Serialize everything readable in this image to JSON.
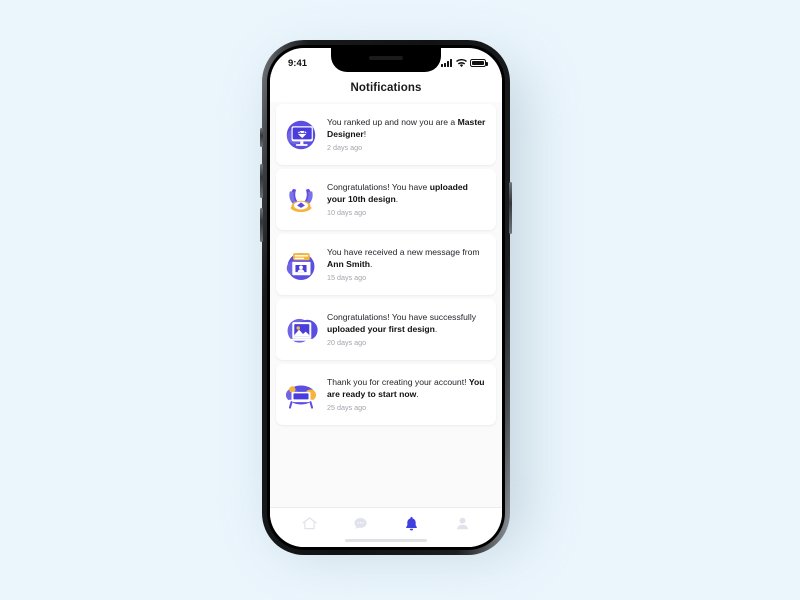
{
  "theme": {
    "page_background": "#eaf5fc",
    "accent": "#3f3fe0",
    "icon_purple": "#4b3fd9",
    "icon_light": "#7b72e8",
    "icon_accent_yellow": "#f5b53d",
    "card_background": "#ffffff",
    "list_background": "#fafafa",
    "muted_text": "#a2a5ac",
    "nav_inactive": "#e0e0e8"
  },
  "status_bar": {
    "time": "9:41",
    "signal_icon": "cellular-bars-icon",
    "wifi_icon": "wifi-icon",
    "battery_icon": "battery-full-icon"
  },
  "header": {
    "title": "Notifications"
  },
  "notifications": [
    {
      "icon": "desktop-gem-icon",
      "text_before": "You ranked up and now you are a ",
      "text_bold": "Master Designer",
      "text_after": "!",
      "time": "2 days ago"
    },
    {
      "icon": "laurel-trophy-icon",
      "text_before": "Congratulations! You have ",
      "text_bold": "uploaded your 10th design",
      "text_after": ".",
      "time": "10 days ago"
    },
    {
      "icon": "mailbox-message-icon",
      "text_before": "You have received a new message from ",
      "text_bold": "Ann Smith",
      "text_after": ".",
      "time": "15 days ago"
    },
    {
      "icon": "photo-upload-icon",
      "text_before": "Congratulations! You have successfully ",
      "text_bold": "uploaded your first design",
      "text_after": ".",
      "time": "20 days ago"
    },
    {
      "icon": "desk-workspace-icon",
      "text_before": "Thank you for creating your account! ",
      "text_bold": "You are ready to start now",
      "text_after": ".",
      "time": "25 days ago"
    }
  ],
  "bottom_nav": [
    {
      "icon": "home-icon",
      "label": "Home",
      "active": false
    },
    {
      "icon": "chat-icon",
      "label": "Messages",
      "active": false
    },
    {
      "icon": "bell-icon",
      "label": "Notifications",
      "active": true
    },
    {
      "icon": "person-icon",
      "label": "Profile",
      "active": false
    }
  ]
}
